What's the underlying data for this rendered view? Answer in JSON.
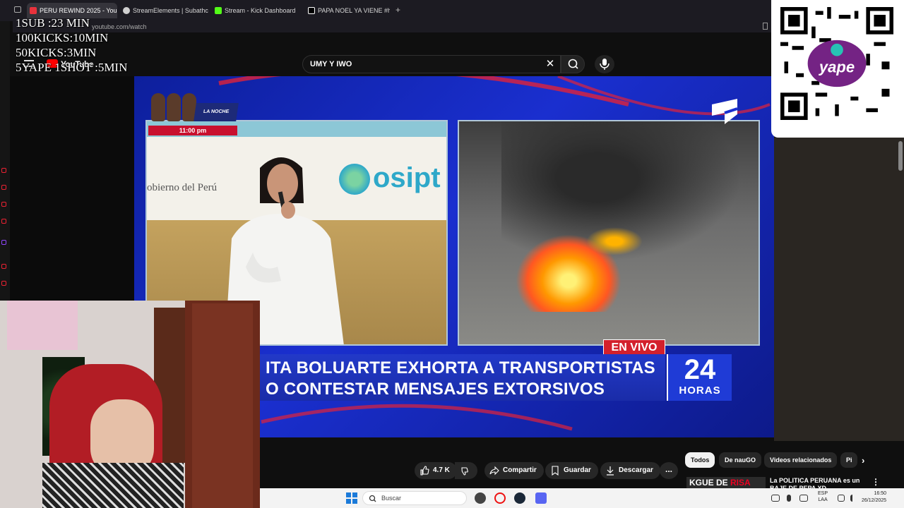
{
  "browser": {
    "tabs": [
      {
        "label": "PERU REWIND 2025 - You",
        "color": "#e8323c",
        "active": true
      },
      {
        "label": "StreamElements | Subathc",
        "color": "#cfcfcf",
        "active": false
      },
      {
        "label": "Stream - Kick Dashboard",
        "color": "#53fc18",
        "active": false
      },
      {
        "label": "PAPA NOEL YA VIENE #hu",
        "color": "#ffffff",
        "active": false
      }
    ],
    "url": "youtube.com/watch"
  },
  "counters": [
    "1SUB :23 MIN",
    "100KICKS:10MIN",
    "50KICKS:3MIN",
    "5YAPE 1SHOT :5MIN"
  ],
  "youtube": {
    "logo_text": "YouTube",
    "search_value": "UMY Y IWO"
  },
  "video": {
    "promo_time": "11:00 pm",
    "promo_badge": "LA NOCHE HABLA",
    "gov_text": "obierno del Perú",
    "osip_text": "osipt",
    "live_label": "EN VIVO",
    "headline_line1": "ITA BOLUARTE EXHORTA A TRANSPORTISTAS",
    "headline_line2": "O CONTESTAR MENSAJES EXTORSIVOS",
    "logo_number": "24",
    "logo_word": "HORAS"
  },
  "actions": {
    "likes": "4.7 K",
    "share": "Compartir",
    "save": "Guardar",
    "download": "Descargar",
    "more": "..."
  },
  "chips": [
    "Todos",
    "De nauGO",
    "Videos relacionados",
    "Pi"
  ],
  "recommendation": {
    "thumb_text_1": "KGUE DE ",
    "thumb_text_2": "RISA",
    "title": "La POLITICA PERUANA es un BAJE DE PEPA XD"
  },
  "taskbar": {
    "search_placeholder": "Buscar",
    "lang_1": "ESP",
    "lang_2": "LAA",
    "time": "16:50",
    "date": "26/12/2025"
  },
  "colors": {
    "accent_red": "#d3202c",
    "news_blue": "#1f3bd6",
    "yape_purple": "#742384"
  }
}
